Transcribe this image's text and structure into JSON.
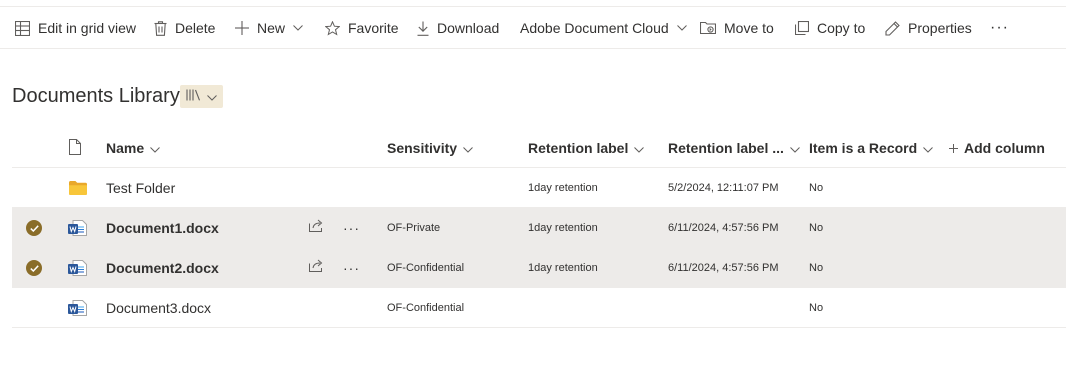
{
  "toolbar": {
    "edit_grid": "Edit in grid view",
    "delete": "Delete",
    "new": "New",
    "favorite": "Favorite",
    "download": "Download",
    "adobe": "Adobe Document Cloud",
    "move_to": "Move to",
    "copy_to": "Copy to",
    "properties": "Properties",
    "more": "···"
  },
  "library": {
    "title": "Documents Library"
  },
  "columns": {
    "name": "Name",
    "sensitivity": "Sensitivity",
    "retention_label": "Retention label",
    "retention_label_applied": "Retention label ...",
    "item_is_record": "Item is a Record",
    "add_column": "Add column"
  },
  "rows": [
    {
      "type": "folder",
      "name": "Test Folder",
      "selected": false,
      "sensitivity": "",
      "retention": "1day retention",
      "applied": "5/2/2024, 12:11:07 PM",
      "record": "No"
    },
    {
      "type": "word",
      "name": "Document1.docx",
      "selected": true,
      "sensitivity": "OF-Private",
      "retention": "1day retention",
      "applied": "6/11/2024, 4:57:56 PM",
      "record": "No"
    },
    {
      "type": "word",
      "name": "Document2.docx",
      "selected": true,
      "sensitivity": "OF-Confidential",
      "retention": "1day retention",
      "applied": "6/11/2024, 4:57:56 PM",
      "record": "No"
    },
    {
      "type": "word",
      "name": "Document3.docx",
      "selected": false,
      "sensitivity": "OF-Confidential",
      "retention": "",
      "applied": "",
      "record": "No"
    }
  ],
  "row_more": "···",
  "icons": {
    "edit_grid": "grid-icon",
    "delete": "trash-icon",
    "new": "plus-icon",
    "favorite": "star-icon",
    "download": "download-icon",
    "move_to": "move-folder-icon",
    "copy_to": "copy-icon",
    "properties": "pencil-icon",
    "view": "library-view-icon",
    "file_type": "document-icon",
    "folder": "folder-icon",
    "word": "word-file-icon",
    "selected": "checkmark-circle-icon",
    "share": "share-icon"
  },
  "colors": {
    "selected_row": "#edebe9",
    "check_accent": "#8a6d29",
    "view_button_bg": "#f1e9d6",
    "folder": "#f8c63a",
    "word_blue": "#2b579a"
  }
}
